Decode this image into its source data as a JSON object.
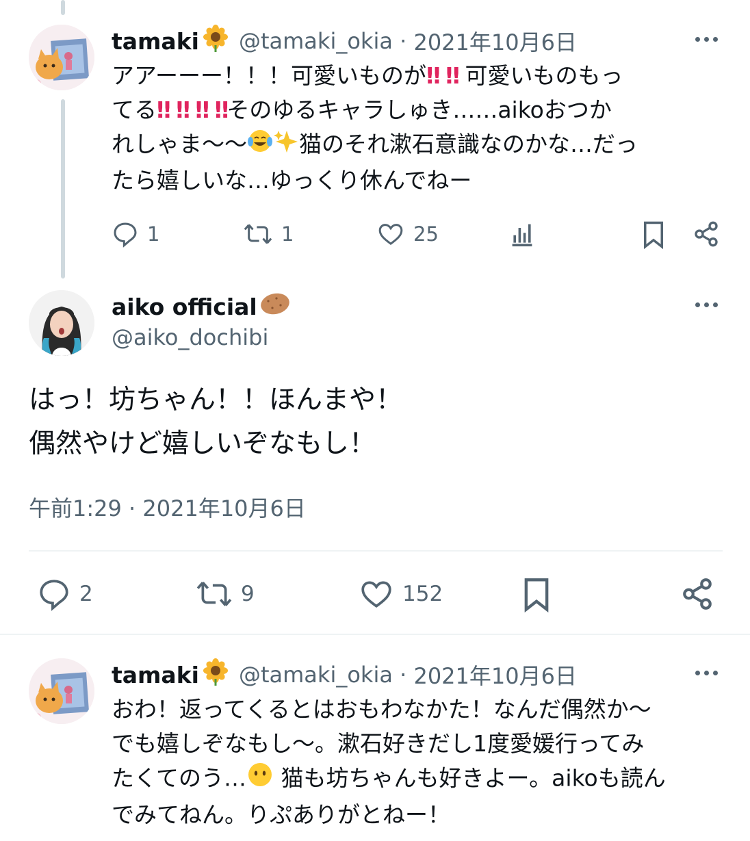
{
  "reply1": {
    "name": "tamaki",
    "handle": "@tamaki_okia",
    "date": "2021年10月6日",
    "lines": [
      [
        "アアーーー！！！可愛いものが",
        "‼",
        "‼",
        "可愛いものもっ"
      ],
      [
        "てる",
        "‼",
        "‼",
        "‼",
        "‼",
        "そのゆるキャラしゅき……aikoおつか"
      ],
      [
        "れしゃま〜〜",
        "😂",
        "✨",
        "猫のそれ漱石意識なのかな…だっ"
      ],
      [
        "たら嬉しいな…ゆっくり休んでねー"
      ]
    ],
    "text_parts": {
      "l1a": "アアーーー！！！可愛いものが",
      "l1b": "可愛いものもっ",
      "l2a": "てる",
      "l2b": "そのゆるキャラしゅき……aikoおつか",
      "l3a": "れしゃま〜〜",
      "l3b": "猫のそれ漱石意識なのかな…だっ",
      "l4": "たら嬉しいな…ゆっくり休んでねー",
      "bang": "‼"
    },
    "replies": "1",
    "retweets": "1",
    "likes": "25"
  },
  "main": {
    "name": "aiko official",
    "handle": "@aiko_dochibi",
    "text_line1": "はっ！坊ちゃん！！ほんまや！",
    "text_line2": "偶然やけど嬉しいぞなもし！",
    "timestamp": "午前1:29 · 2021年10月6日",
    "replies": "2",
    "retweets": "9",
    "likes": "152"
  },
  "reply2": {
    "name": "tamaki",
    "handle": "@tamaki_okia",
    "date": "2021年10月6日",
    "l1": "おわ！返ってくるとはおもわなかた！なんだ偶然か〜",
    "l2": "でも嬉しぞなもし〜。漱石好きだし1度愛媛行ってみ",
    "l3a": "たくてのう…",
    "l3b": " 猫も坊ちゃんも好きよー。aikoも読ん",
    "l4": "でみてねん。りぷありがとねー！"
  },
  "separator": " · ",
  "colors": {
    "text": "#0f1419",
    "muted": "#536471",
    "thread": "#cfd9de",
    "divider": "#eff3f4"
  },
  "icons": [
    "reply-icon",
    "retweet-icon",
    "like-icon",
    "analytics-icon",
    "bookmark-icon",
    "share-icon",
    "more-icon",
    "sunflower-emoji",
    "potato-emoji"
  ]
}
